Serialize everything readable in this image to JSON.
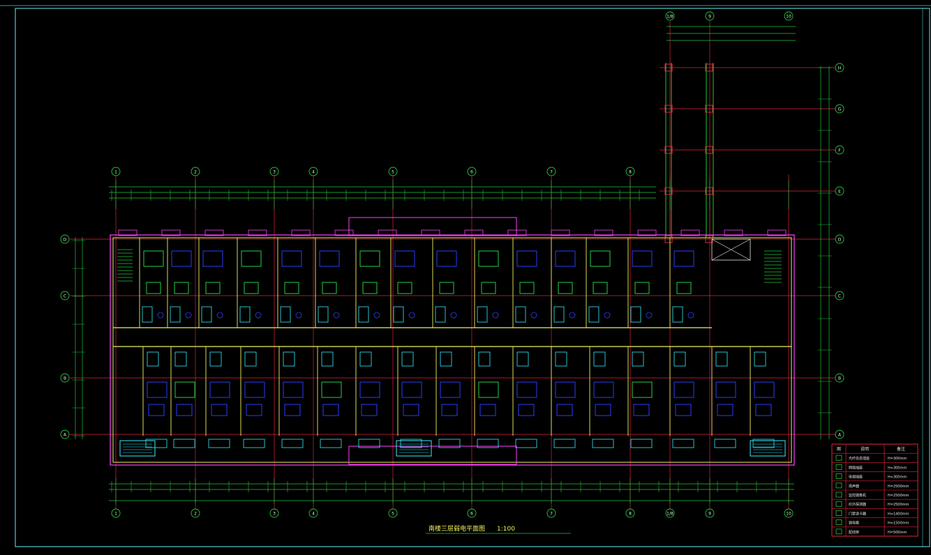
{
  "drawing": {
    "title": "南楼三层弱电平面图",
    "scale": "1:100",
    "colors": {
      "background": "#000000",
      "frame": "#57c6ce",
      "axis": "#e0233c",
      "dimension": "#22c63a",
      "wall": "#f0f060",
      "furniture_blue": "#2a3cff",
      "furniture_green": "#22d04a",
      "cyan": "#30f0ff",
      "magenta": "#ff40ff",
      "white": "#e8e8e8"
    }
  },
  "axes": {
    "columns_bottom": [
      "1",
      "2",
      "3",
      "4",
      "5",
      "6",
      "7",
      "8",
      "1/8",
      "9",
      "10"
    ],
    "columns_top": [
      "1",
      "2",
      "3",
      "4",
      "5",
      "6",
      "7",
      "8"
    ],
    "columns_wing": [
      "1/8",
      "9",
      "10"
    ],
    "rows_left": [
      "D",
      "C",
      "B",
      "A"
    ],
    "rows_right": [
      "H",
      "G",
      "F",
      "E",
      "D",
      "C",
      "B",
      "A"
    ]
  },
  "legend": {
    "headers": [
      "图",
      "说明",
      "备注"
    ],
    "rows": [
      {
        "icon": "phone-icon",
        "name": "光纤信息插座",
        "note": "H=300mm"
      },
      {
        "icon": "data-outlet-icon",
        "name": "网络插座",
        "note": "H=300mm"
      },
      {
        "icon": "tv-outlet-icon",
        "name": "电视插座",
        "note": "H=300mm"
      },
      {
        "icon": "speaker-icon",
        "name": "扬声器",
        "note": "H=2500mm"
      },
      {
        "icon": "camera-icon",
        "name": "监控摄像机",
        "note": "H=2500mm"
      },
      {
        "icon": "detector-icon",
        "name": "红外探测器",
        "note": "H=2500mm"
      },
      {
        "icon": "reader-icon",
        "name": "门禁读卡器",
        "note": "H=1400mm"
      },
      {
        "icon": "box-icon",
        "name": "弱电箱",
        "note": "H=1500mm"
      },
      {
        "icon": "distribution-icon",
        "name": "配线架",
        "note": "H=500mm"
      }
    ]
  }
}
